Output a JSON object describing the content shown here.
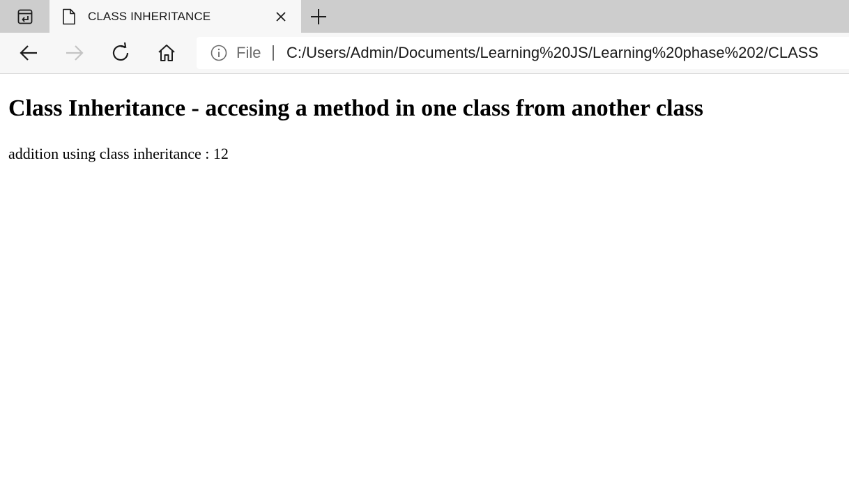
{
  "browser": {
    "tab": {
      "title": "CLASS INHERITANCE",
      "icon": "document-icon"
    },
    "tab_actions_icon": "tab-actions-icon",
    "new_tab_icon": "plus-icon",
    "close_tab_icon": "close-icon",
    "toolbar": {
      "back_icon": "arrow-left-icon",
      "forward_icon": "arrow-right-icon",
      "forward_enabled": false,
      "refresh_icon": "refresh-icon",
      "home_icon": "home-icon"
    },
    "address_bar": {
      "info_icon": "info-icon",
      "scheme_label": "File",
      "url": "C:/Users/Admin/Documents/Learning%20JS/Learning%20phase%202/CLASS"
    }
  },
  "page": {
    "heading": "Class Inheritance - accesing a method in one class from another class",
    "result_text": "addition using class inheritance : 12"
  },
  "colors": {
    "tabstrip_bg": "#cdcdcd",
    "toolbar_bg": "#f7f7f7",
    "text": "#1b1b1b",
    "muted": "#6b6b6b",
    "disabled": "#c4c4c4"
  }
}
